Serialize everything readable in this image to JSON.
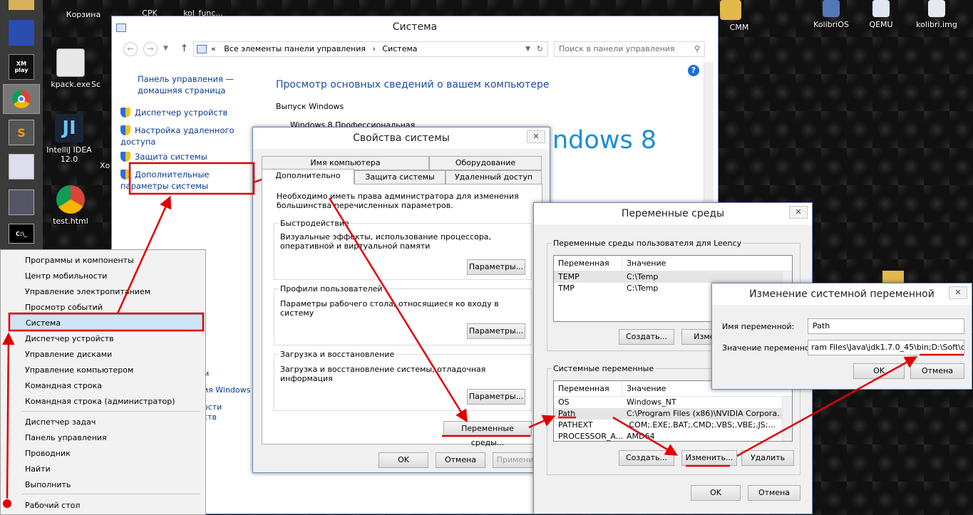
{
  "desktop": {
    "icons": [
      {
        "label": "Корзина"
      },
      {
        "label": "CPK"
      },
      {
        "label": "kol_func..."
      },
      {
        "label": "kpack.exe"
      },
      {
        "label": "Sc"
      },
      {
        "label": "IntelliJ IDEA 12.0"
      },
      {
        "label": "Xo"
      },
      {
        "label": "test.html"
      },
      {
        "label": "CMM"
      },
      {
        "label": "KolibriOS"
      },
      {
        "label": "QEMU"
      },
      {
        "label": "kolibri.img"
      }
    ]
  },
  "taskbar": {
    "xm_label": "XM play"
  },
  "system_window": {
    "title": "Система",
    "address": {
      "prefix": "«",
      "item1": "Все элементы панели управления",
      "sep": "›",
      "item2": "Система"
    },
    "search_placeholder": "Поиск в панели управления",
    "sidebar": {
      "home_link": "Панель управления — домашняя страница",
      "items": [
        "Диспетчер устройств",
        "Настройка удаленного доступа",
        "Защита системы",
        "Дополнительные параметры системы"
      ],
      "partial1": "м",
      "partial2": "ия Windows",
      "partial3": "ости",
      "partial4": "ств"
    },
    "heading": "Просмотр основных сведений о вашем компьютере",
    "edition_label": "Выпуск Windows",
    "edition_value": "Windows 8 Профессиональная",
    "logo_text": "ndows 8",
    "help_icon": "?"
  },
  "sysprops": {
    "title": "Свойства системы",
    "tabs_top": [
      "Имя компьютера",
      "Оборудование"
    ],
    "tabs_bottom": [
      "Дополнительно",
      "Защита системы",
      "Удаленный доступ"
    ],
    "admin_note": "Необходимо иметь права администратора для изменения большинства перечисленных параметров.",
    "groups": [
      {
        "title": "Быстродействие",
        "text": "Визуальные эффекты, использование процессора, оперативной и виртуальной памяти",
        "button": "Параметры..."
      },
      {
        "title": "Профили пользователей",
        "text": "Параметры рабочего стола, относящиеся ко входу в систему",
        "button": "Параметры..."
      },
      {
        "title": "Загрузка и восстановление",
        "text": "Загрузка и восстановление системы, отладочная информация",
        "button": "Параметры..."
      }
    ],
    "env_button": "Переменные среды...",
    "ok": "OK",
    "cancel": "Отмена",
    "apply": "Применить"
  },
  "envvars": {
    "title": "Переменные среды",
    "user_group": "Переменные среды пользователя для Leency",
    "col_var": "Переменная",
    "col_val": "Значение",
    "user_rows": [
      {
        "name": "TEMP",
        "value": "C:\\Temp"
      },
      {
        "name": "TMP",
        "value": "C:\\Temp"
      }
    ],
    "user_create": "Создать...",
    "user_edit": "Измени",
    "sys_group": "Системные переменные",
    "sys_rows": [
      {
        "name": "OS",
        "value": "Windows_NT"
      },
      {
        "name": "Path",
        "value": "C:\\Program Files (x86)\\NVIDIA Corpora..."
      },
      {
        "name": "PATHEXT",
        "value": ".COM;.EXE;.BAT;.CMD;.VBS;.VBE;.JS;..."
      },
      {
        "name": "PROCESSOR_A...",
        "value": "AMD64"
      }
    ],
    "sys_create": "Создать...",
    "sys_edit": "Изменить...",
    "sys_delete": "Удалить",
    "ok": "OK",
    "cancel": "Отмена"
  },
  "editvar": {
    "title": "Изменение системной переменной",
    "name_label": "Имя переменной:",
    "name_value": "Path",
    "value_label": "Значение переменной:",
    "value_value": "ram Files\\Java\\jdk1.7.0_45\\bin;D:\\Soft\\c--",
    "ok": "OK",
    "cancel": "Отмена"
  },
  "context_menu": {
    "items": [
      "Программы и компоненты",
      "Центр мобильности",
      "Управление электропитанием",
      "Просмотр событий",
      "Система",
      "Диспетчер устройств",
      "Управление дисками",
      "Управление компьютером",
      "Командная строка",
      "Командная строка (администратор)"
    ],
    "items2": [
      "Диспетчер задач",
      "Панель управления",
      "Проводник",
      "Найти",
      "Выполнить"
    ],
    "items3": [
      "Рабочий стол"
    ]
  },
  "colors": {
    "annotation": "#e00000",
    "link": "#0b3a8f",
    "heading": "#1a4f9c",
    "win8": "#1a8fd6"
  }
}
